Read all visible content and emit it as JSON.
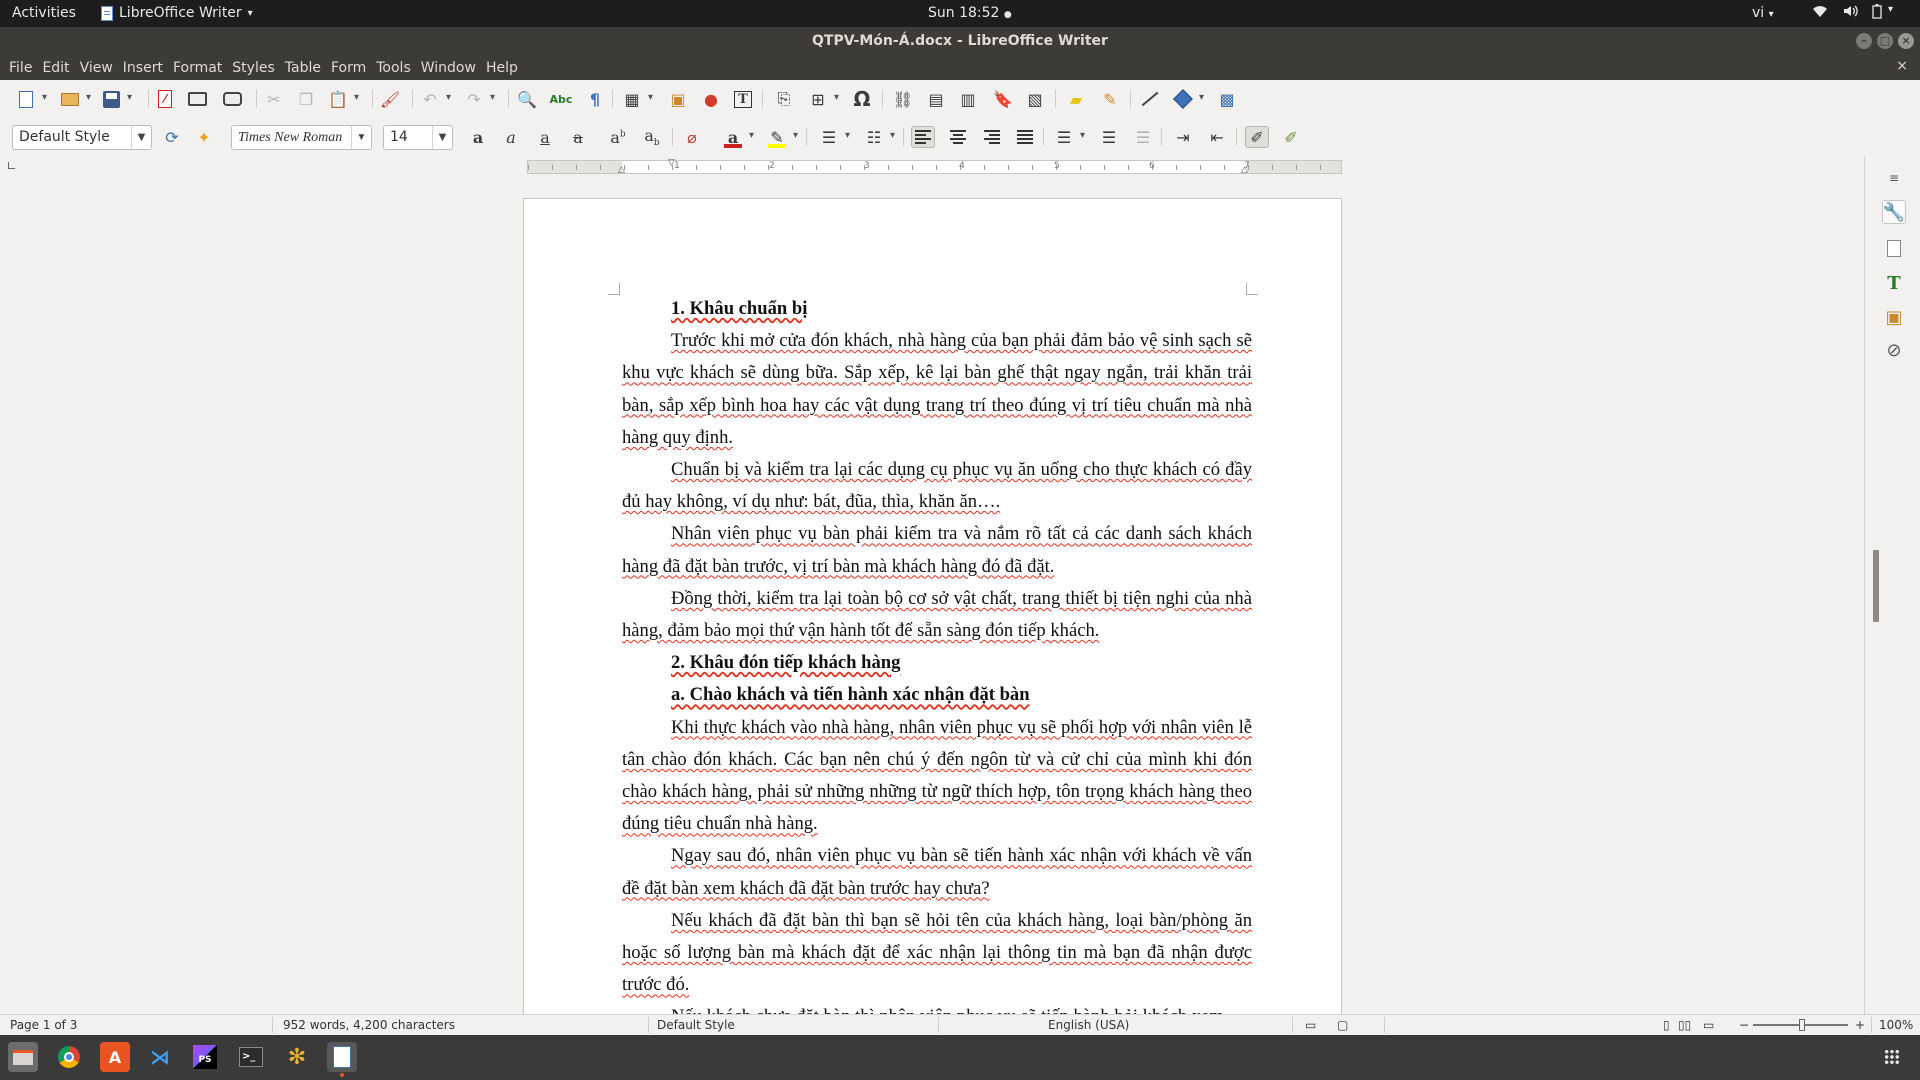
{
  "topbar": {
    "activities": "Activities",
    "app_name": "LibreOffice Writer",
    "clock": "Sun 18:52",
    "language": "vi"
  },
  "window": {
    "title": "QTPV-Món-Á.docx - LibreOffice Writer"
  },
  "menubar": {
    "items": [
      "File",
      "Edit",
      "View",
      "Insert",
      "Format",
      "Styles",
      "Table",
      "Form",
      "Tools",
      "Window",
      "Help"
    ]
  },
  "formatting": {
    "paragraph_style": "Default Style",
    "font_name": "Times New Roman",
    "font_size": "14"
  },
  "ruler": {
    "numbers": [
      "1",
      "2",
      "3",
      "4",
      "5",
      "6",
      "7"
    ]
  },
  "document": {
    "paragraphs": [
      {
        "type": "heading",
        "text": "1. Khâu chuẩn bị"
      },
      {
        "type": "body",
        "text": "Trước khi mở cửa đón khách, nhà hàng của bạn phải đảm bảo vệ sinh sạch sẽ khu vực khách sẽ dùng bữa. Sắp xếp, kê lại bàn ghế thật ngay ngắn, trải khăn trải bàn, sắp xếp bình hoa hay các vật dụng trang trí theo đúng vị trí tiêu chuẩn mà nhà hàng quy định."
      },
      {
        "type": "body",
        "text": "Chuẩn bị và kiểm tra lại các dụng cụ phục vụ ăn uống cho thực khách có đầy đủ hay không, ví dụ như: bát, đũa, thìa, khăn ăn…."
      },
      {
        "type": "body",
        "text": "Nhân viên phục vụ bàn phải kiểm tra và nắm rõ tất cả các danh sách khách hàng đã đặt bàn trước, vị trí bàn mà khách hàng đó đã đặt."
      },
      {
        "type": "body",
        "text": "Đồng thời, kiểm tra lại toàn bộ cơ sở vật chất, trang thiết bị tiện nghi của nhà hàng, đảm bảo mọi thứ vận hành tốt để sẵn sàng đón tiếp khách."
      },
      {
        "type": "heading",
        "text": "2. Khâu đón tiếp khách hàng"
      },
      {
        "type": "heading",
        "text": "a. Chào khách và tiến hành xác nhận đặt bàn"
      },
      {
        "type": "body",
        "text": "Khi thực khách vào nhà hàng, nhân viên phục vụ sẽ phối hợp với nhân viên lễ tân chào đón khách. Các bạn nên chú ý đến ngôn từ và cử chỉ của mình khi đón chào khách hàng, phải sử những những từ ngữ thích hợp, tôn trọng khách hàng theo đúng tiêu chuẩn nhà hàng."
      },
      {
        "type": "body",
        "text": "Ngay sau đó, nhân viên phục vụ bàn sẽ tiến hành xác nhận với khách về vấn đề đặt bàn xem khách đã đặt bàn trước hay chưa?"
      },
      {
        "type": "body",
        "text": "Nếu khách đã đặt bàn thì bạn sẽ hỏi tên của khách hàng, loại bàn/phòng ăn hoặc số lượng bàn mà khách đặt để xác nhận lại thông tin mà bạn đã nhận được trước đó."
      },
      {
        "type": "body",
        "text": "Nếu khách chưa đặt bàn thì nhân viên phục vụ sẽ tiến hành hỏi khách xem"
      }
    ]
  },
  "statusbar": {
    "page": "Page 1 of 3",
    "words": "952 words, 4,200 characters",
    "style": "Default Style",
    "language": "English (USA)",
    "zoom_label": "100%",
    "zoom_percent": 100
  },
  "colors": {
    "accent": "#e95420",
    "scrollbar_thumb": "#e9825a",
    "titlebar": "#3c3b37",
    "spellcheck": "#e0301e"
  },
  "dock": {
    "apps": [
      "files-icon",
      "chrome-icon",
      "software-center-icon",
      "vscode-icon",
      "phpstorm-icon",
      "terminal-icon",
      "slack-icon",
      "writer-icon"
    ],
    "phpstorm_label": "PS"
  }
}
